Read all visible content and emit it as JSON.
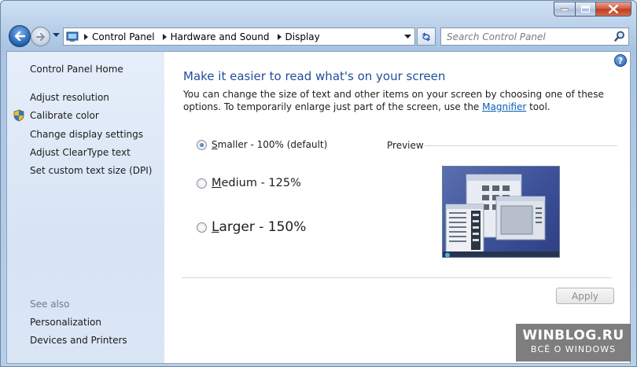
{
  "window": {
    "caption": {
      "minimize": "minimize",
      "maximize": "maximize",
      "close": "close"
    }
  },
  "navbar": {
    "breadcrumbs": [
      "Control Panel",
      "Hardware and Sound",
      "Display"
    ],
    "search_placeholder": "Search Control Panel"
  },
  "sidebar": {
    "home": "Control Panel Home",
    "links": [
      "Adjust resolution",
      "Calibrate color",
      "Change display settings",
      "Adjust ClearType text",
      "Set custom text size (DPI)"
    ],
    "see_also_header": "See also",
    "see_also": [
      "Personalization",
      "Devices and Printers"
    ]
  },
  "main": {
    "help_label": "?",
    "heading": "Make it easier to read what's on your screen",
    "desc_before": "You can change the size of text and other items on your screen by choosing one of these options. To temporarily enlarge just part of the screen, use the ",
    "desc_link": "Magnifier",
    "desc_after": " tool.",
    "options": [
      {
        "accel": "S",
        "rest": "maller - 100% (default)",
        "selected": true
      },
      {
        "accel": "M",
        "rest": "edium - 125%",
        "selected": false
      },
      {
        "accel": "L",
        "rest": "arger - 150%",
        "selected": false
      }
    ],
    "preview_label": "Preview",
    "apply_label": "Apply"
  },
  "watermark": {
    "line1": "WINBLOG.RU",
    "line2": "ВСЁ О WINDOWS"
  },
  "colors": {
    "accent": "#1f4e9b",
    "link": "#0b5cb8",
    "sidebar": "#dbe6f5"
  }
}
